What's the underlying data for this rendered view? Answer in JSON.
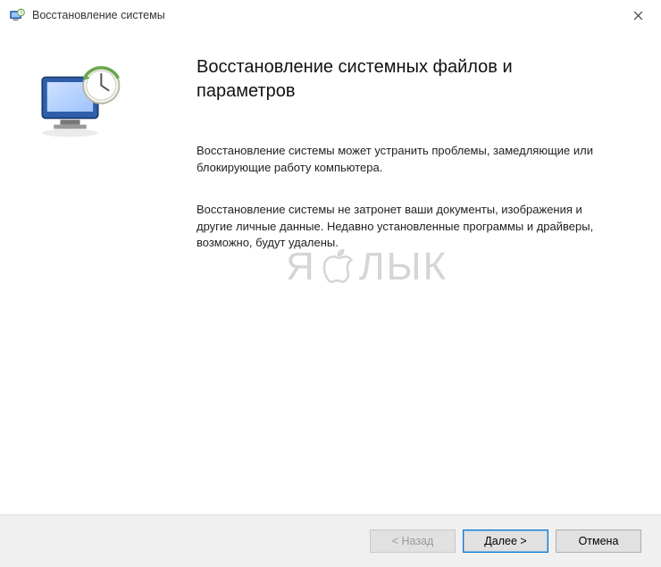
{
  "window": {
    "title": "Восстановление системы"
  },
  "content": {
    "heading": "Восстановление системных файлов и параметров",
    "paragraph1": "Восстановление системы может устранить проблемы, замедляющие или блокирующие работу компьютера.",
    "paragraph2": "Восстановление системы не затронет ваши документы, изображения и другие личные данные. Недавно установленные программы и драйверы, возможно, будут удалены."
  },
  "watermark": {
    "left": "Я",
    "right": "ЛЫК"
  },
  "footer": {
    "back": "< Назад",
    "next": "Далее >",
    "cancel": "Отмена"
  },
  "icons": {
    "app": "system-restore-icon",
    "close": "close-icon",
    "hero": "monitor-clock-icon",
    "watermark_apple": "apple-outline-icon"
  }
}
